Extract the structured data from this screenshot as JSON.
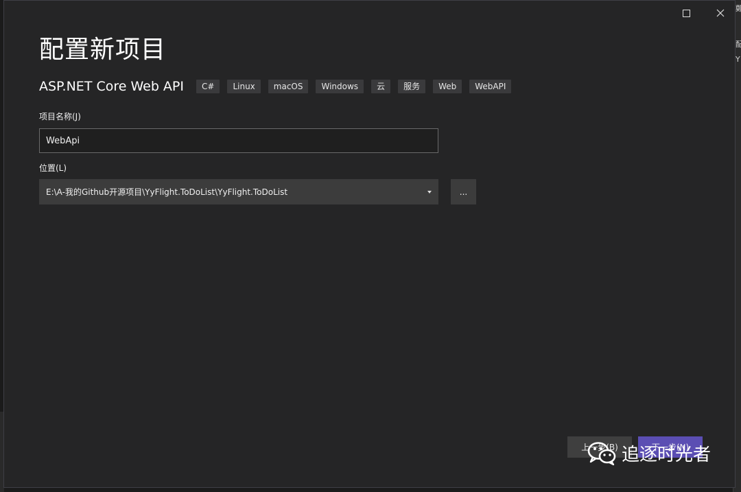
{
  "background": {
    "right_strip_chars": [
      "鄭",
      "配",
      "Y"
    ]
  },
  "window": {
    "maximize_icon": "maximize-icon",
    "close_icon": "close-icon"
  },
  "page": {
    "title": "配置新项目"
  },
  "template": {
    "name": "ASP.NET Core Web API",
    "tags": [
      "C#",
      "Linux",
      "macOS",
      "Windows",
      "云",
      "服务",
      "Web",
      "WebAPI"
    ]
  },
  "project_name": {
    "label": "项目名称(J)",
    "value": "WebApi"
  },
  "location": {
    "label": "位置(L)",
    "value": "E:\\A-我的Github开源项目\\YyFlight.ToDoList\\YyFlight.ToDoList",
    "browse_label": "..."
  },
  "footer": {
    "back_label": "上一步(B)",
    "next_label": "下一步(N)"
  },
  "watermark": {
    "icon": "wechat-icon",
    "text": "追逐时光者"
  },
  "colors": {
    "dialog_bg": "#252526",
    "tag_bg": "#3a3a3c",
    "accent": "#5b4eb3"
  }
}
